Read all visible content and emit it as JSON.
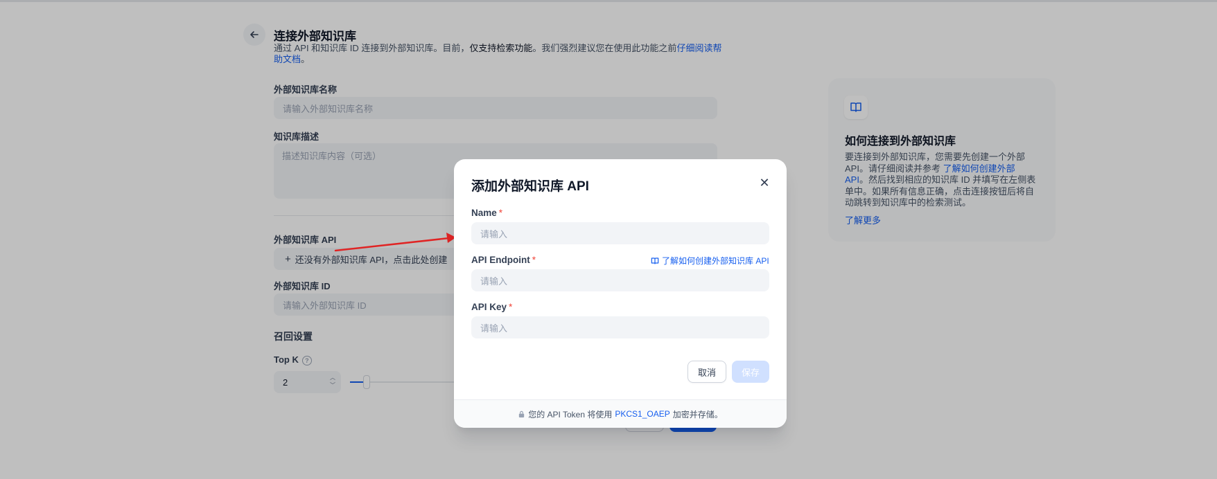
{
  "page": {
    "title": "连接外部知识库",
    "description": {
      "part1": "通过 API 和知识库 ID 连接到外部知识库。目前，",
      "strong": "仅支持检索功能",
      "part2": "。我们强烈建议您在使用此功能之前",
      "link": "仔细阅读帮助文档",
      "end": "。"
    }
  },
  "form": {
    "name_label": "外部知识库名称",
    "name_placeholder": "请输入外部知识库名称",
    "desc_label": "知识库描述",
    "desc_placeholder": "描述知识库内容（可选）",
    "api_label": "外部知识库 API",
    "api_create_button": "还没有外部知识库 API，点击此处创建",
    "id_label": "外部知识库 ID",
    "id_placeholder": "请输入外部知识库 ID",
    "recall_label": "召回设置",
    "topk_label": "Top K",
    "topk_value": "2"
  },
  "help_card": {
    "title": "如何连接到外部知识库",
    "body_part1": "要连接到外部知识库，您需要先创建一个外部 API。请仔细阅读并参考 ",
    "body_link": "了解如何创建外部 API",
    "body_part2": "。然后找到相应的知识库 ID 并填写在左侧表单中。如果所有信息正确，点击连接按钮后将自动跳转到知识库中的检索测试。",
    "more_link": "了解更多"
  },
  "modal": {
    "title": "添加外部知识库 API",
    "name_label": "Name",
    "name_placeholder": "请输入",
    "endpoint_label": "API Endpoint",
    "endpoint_doc_link": "了解如何创建外部知识库 API",
    "endpoint_placeholder": "请输入",
    "key_label": "API Key",
    "key_placeholder": "请输入",
    "required_mark": "*",
    "cancel_button": "取消",
    "save_button": "保存",
    "footer_part1": "您的 API Token 将使用",
    "footer_link": "PKCS1_OAEP",
    "footer_part2": "加密并存储。"
  },
  "icons": {
    "back": "arrow-left-icon",
    "book": "book-open-icon",
    "close": "close-icon",
    "plus": "plus-icon",
    "lock": "lock-icon",
    "help": "question-circle-icon"
  },
  "colors": {
    "accent": "#155eef",
    "required": "#f04438",
    "annotation_arrow": "#e02424"
  }
}
